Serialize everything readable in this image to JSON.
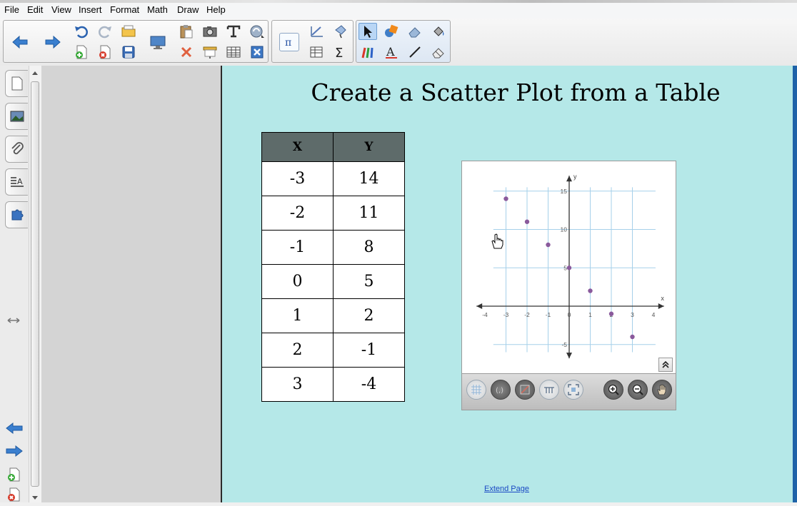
{
  "menu": [
    "File",
    "Edit",
    "View",
    "Insert",
    "Format",
    "Math",
    "Draw",
    "Help"
  ],
  "page": {
    "title": "Create a Scatter Plot from a Table",
    "table": {
      "headers": [
        "X",
        "Y"
      ],
      "rows": [
        [
          "-3",
          "14"
        ],
        [
          "-2",
          "11"
        ],
        [
          "-1",
          "8"
        ],
        [
          "0",
          "5"
        ],
        [
          "1",
          "2"
        ],
        [
          "2",
          "-1"
        ],
        [
          "3",
          "-4"
        ]
      ]
    },
    "extend_link": "Extend Page"
  },
  "toolbar_icons": [
    "back-arrow-icon",
    "forward-arrow-icon",
    "undo-icon",
    "redo-icon",
    "open-folder-icon",
    "add-page-icon",
    "delete-page-icon",
    "save-icon",
    "screen-display-icon",
    "paste-icon",
    "screen-capture-icon",
    "text-tool-icon",
    "delete-icon",
    "screen-shade-icon",
    "table-icon",
    "equation-icon",
    "graph-icon",
    "select-icon",
    "pen-icon",
    "shape-icon",
    "eraser-icon",
    "fill-icon",
    "line-icon",
    "sigma-icon",
    "text-a-icon"
  ],
  "colors": {
    "canvas": "#b5e8e8",
    "point": "#8a5a9c",
    "grid": "#a6d0ea",
    "table_header": "#5e6b6a",
    "link": "#1a49c4"
  },
  "chart_data": {
    "type": "scatter",
    "x": [
      -3,
      -2,
      -1,
      0,
      1,
      2,
      3
    ],
    "y": [
      14,
      11,
      8,
      5,
      2,
      -1,
      -4
    ],
    "xlabel": "x",
    "ylabel": "y",
    "xlim": [
      -4,
      4
    ],
    "ylim": [
      -5,
      15
    ],
    "x_ticks": [
      "-4",
      "-3",
      "-2",
      "-1",
      "0",
      "1",
      "2",
      "3",
      "4"
    ],
    "y_ticks": [
      "15",
      "10",
      "5",
      "-5"
    ],
    "grid": true
  }
}
